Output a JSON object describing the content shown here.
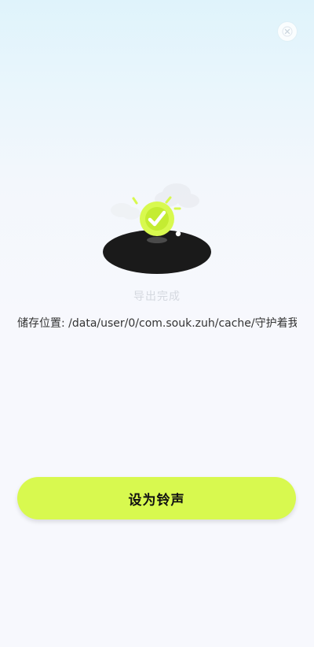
{
  "top_bar": {
    "title": "",
    "close_icon": "close-icon"
  },
  "illustration": {
    "icons": [
      "checkmark-icon",
      "cloud-icon",
      "disc-icon"
    ],
    "accent_color": "#d8f94f",
    "disc_color": "#1a1a1a"
  },
  "status": {
    "message": "导出完成",
    "storage_path": "储存位置: /data/user/0/com.souk.zuh/cache/守护着我…"
  },
  "actions": {
    "set_ringtone_label": "设为铃声"
  },
  "colors": {
    "button_bg": "#d8f94f",
    "text_primary": "#333333"
  }
}
